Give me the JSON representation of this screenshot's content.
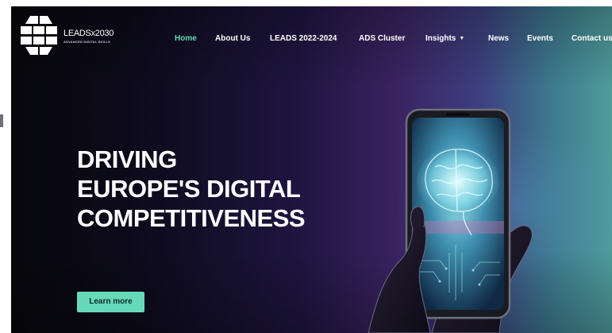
{
  "brand": {
    "name": "LEADSx2030",
    "tagline": "ADVANCED DIGITAL SKILLS"
  },
  "nav": {
    "items": [
      {
        "label": "Home",
        "active": true
      },
      {
        "label": "About Us",
        "active": false
      },
      {
        "label": "LEADS 2022-2024",
        "active": false
      },
      {
        "label": "ADS Cluster",
        "active": false
      },
      {
        "label": "Insights",
        "active": false,
        "dropdown": true
      },
      {
        "label": "News",
        "active": false
      },
      {
        "label": "Events",
        "active": false
      },
      {
        "label": "Contact us",
        "active": false
      }
    ],
    "dropdown_icon": "chevron-down-icon"
  },
  "hero": {
    "headline_lines": [
      "DRIVING",
      "EUROPE'S DIGITAL",
      "COMPETITIVENESS"
    ],
    "cta_label": "Learn more",
    "illustration": "hands-holding-smartphone-with-glowing-brain"
  },
  "colors": {
    "accent": "#5ddbb8",
    "button": "#66d9b8",
    "background_dark": "#07070c",
    "background_purple": "#3a2260",
    "background_teal": "#4f9c9c"
  }
}
